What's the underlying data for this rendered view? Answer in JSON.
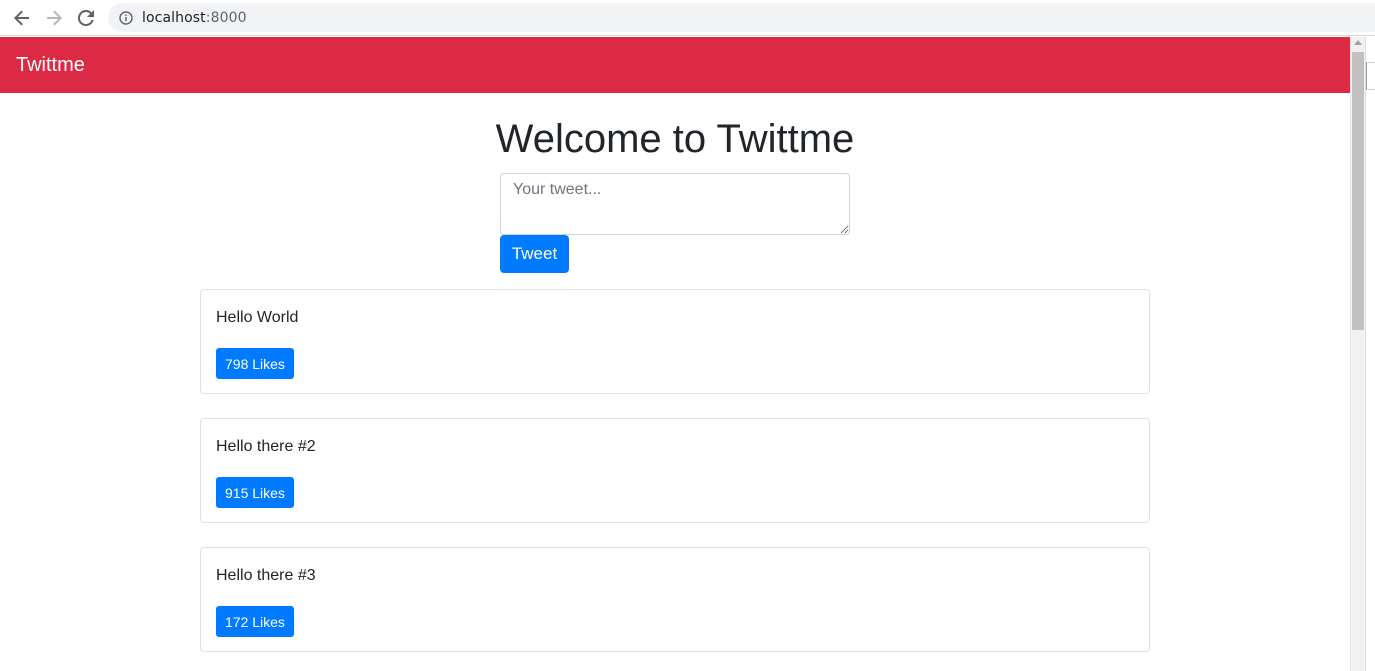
{
  "browser": {
    "url_host": "localhost",
    "url_port": ":8000",
    "back_icon": "arrow-left-icon",
    "forward_icon": "arrow-right-icon",
    "reload_icon": "reload-icon",
    "info_icon": "info-icon"
  },
  "navbar": {
    "brand": "Twittme",
    "color": "#dc2a44"
  },
  "main": {
    "heading": "Welcome to Twittme",
    "tweet_placeholder": "Your tweet...",
    "tweet_button": "Tweet"
  },
  "tweets": [
    {
      "text": "Hello World",
      "likes_label": "798 Likes"
    },
    {
      "text": "Hello there #2",
      "likes_label": "915 Likes"
    },
    {
      "text": "Hello there #3",
      "likes_label": "172 Likes"
    }
  ],
  "colors": {
    "primary": "#007bff",
    "brand": "#dc2a44"
  }
}
